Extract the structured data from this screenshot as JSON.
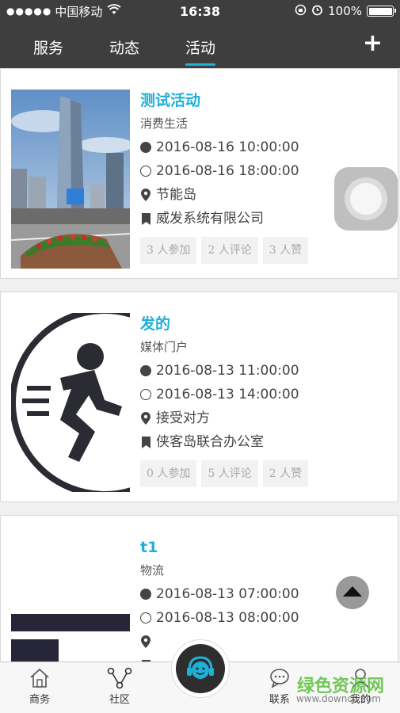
{
  "status_bar": {
    "signal": "●●●●●",
    "carrier": "中国移动",
    "time": "16:38",
    "battery": "100%",
    "battery_level": 1.0
  },
  "nav": {
    "tabs": [
      {
        "label": "服务"
      },
      {
        "label": "动态"
      },
      {
        "label": "活动"
      }
    ],
    "active_tab": "活动",
    "add_label": "+"
  },
  "cards": [
    {
      "title": "测试活动",
      "category": "消费生活",
      "start": "2016-08-16 10:00:00",
      "end": "2016-08-16 18:00:00",
      "location": "节能岛",
      "organizer": "威发系统有限公司",
      "joined": "3 人参加",
      "comments": "2 人评论",
      "likes": "3 人赞"
    },
    {
      "title": "发的",
      "category": "媒体门户",
      "start": "2016-08-13 11:00:00",
      "end": "2016-08-13 14:00:00",
      "location": "接受对方",
      "organizer": "侠客岛联合办公室",
      "joined": "0 人参加",
      "comments": "5 人评论",
      "likes": "2 人赞"
    },
    {
      "title": "t1",
      "category": "物流",
      "start": "2016-08-13 07:00:00",
      "end": "2016-08-13 08:00:00",
      "location": "",
      "organizer": ""
    }
  ],
  "tab_bar": {
    "items": [
      {
        "label": "商务",
        "icon": "home-icon"
      },
      {
        "label": "社区",
        "icon": "share-network-icon"
      },
      {
        "label": "",
        "icon": "customer-service-icon"
      },
      {
        "label": "联系",
        "icon": "chat-icon"
      },
      {
        "label": "我的",
        "icon": "user-icon"
      }
    ]
  },
  "watermark": {
    "text": "绿色资源网",
    "url": "www.downcc.com"
  },
  "colors": {
    "accent": "#1fb0d8",
    "header_bg": "#3e3e3e"
  }
}
